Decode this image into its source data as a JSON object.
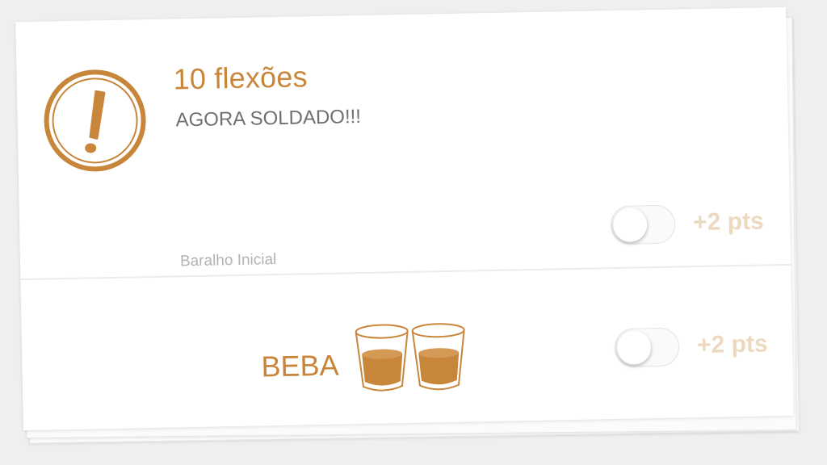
{
  "card": {
    "title": "10 flexões",
    "subtitle": "AGORA SOLDADO!!!",
    "deck_name": "Baralho Inicial",
    "icon": "exclamation-circle-icon",
    "accent_color": "#c8863a"
  },
  "rows": [
    {
      "points_label": "+2 pts",
      "toggle_on": false
    },
    {
      "points_label": "+2 pts",
      "toggle_on": false
    }
  ],
  "drink": {
    "label": "BEBA",
    "icon": "two-shot-glasses-icon"
  }
}
